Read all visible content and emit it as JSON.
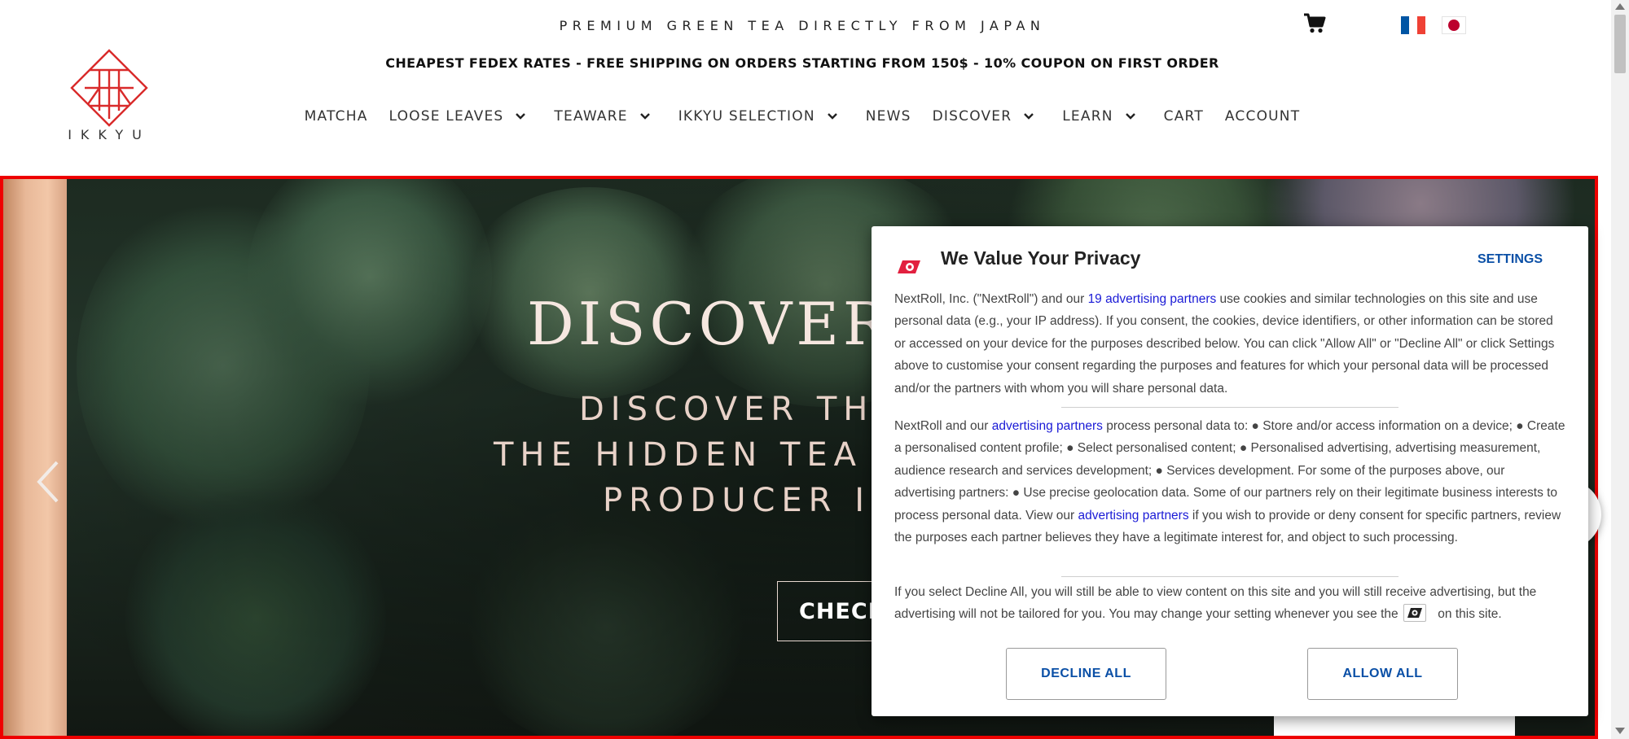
{
  "header": {
    "tagline": "PREMIUM GREEN TEA DIRECTLY FROM JAPAN",
    "promo": "CHEAPEST FEDEX RATES - FREE SHIPPING ON ORDERS STARTING FROM 150$ - 10% COUPON ON FIRST ORDER",
    "logo_text": "IKKYU",
    "cart_icon": "shopping-cart-icon",
    "flags": [
      "france-flag-icon",
      "japan-flag-icon"
    ],
    "nav": [
      {
        "label": "MATCHA",
        "dropdown": false
      },
      {
        "label": "LOOSE LEAVES",
        "dropdown": true
      },
      {
        "label": "TEAWARE",
        "dropdown": true
      },
      {
        "label": "IKKYU SELECTION",
        "dropdown": true
      },
      {
        "label": "NEWS",
        "dropdown": false
      },
      {
        "label": "DISCOVER",
        "dropdown": true
      },
      {
        "label": "LEARN",
        "dropdown": true
      },
      {
        "label": "CART",
        "dropdown": false
      },
      {
        "label": "ACCOUNT",
        "dropdown": false
      }
    ]
  },
  "hero": {
    "title": "DISCOVER",
    "subtitle_lines": [
      "DISCOVER TH",
      "THE HIDDEN TEA",
      "PRODUCER IN"
    ],
    "cta_label": "CHECK",
    "prev_icon": "chevron-left-icon"
  },
  "consent": {
    "title": "We Value Your Privacy",
    "settings_label": "SETTINGS",
    "p1_a": "NextRoll, Inc. (\"NextRoll\") and our ",
    "p1_link": "19 advertising partners",
    "p1_b": " use cookies and similar technologies on this site and use personal data (e.g., your IP address). If you consent, the cookies, device identifiers, or other information can be stored or accessed on your device for the purposes described below. You can click \"Allow All\" or \"Decline All\" or click Settings above to customise your consent regarding the purposes and features for which your personal data will be processed and/or the partners with whom you will share personal data.",
    "p2_a": "NextRoll and our ",
    "p2_link1": "advertising partners",
    "p2_b": " process personal data to: ● Store and/or access information on a device; ● Create a personalised content profile; ● Select personalised content; ● Personalised advertising, advertising measurement, audience research and services development; ● Services development. For some of the purposes above, our advertising partners: ● Use precise geolocation data. Some of our partners rely on their legitimate business interests to process personal data. View our ",
    "p2_link2": "advertising partners",
    "p2_c": " if you wish to provide or deny consent for specific partners, review the purposes each partner believes they have a legitimate interest for, and object to such processing.",
    "p3_a": "If you select Decline All, you will still be able to view content on this site and you will still receive advertising, but the advertising will not be tailored for you. You may change your setting whenever you see the ",
    "p3_b": " on this site.",
    "decline_label": "DECLINE ALL",
    "allow_label": "ALLOW ALL",
    "brand_color": "#e2203f",
    "link_color": "#1a1ad6",
    "button_text_color": "#0a4fa6"
  },
  "colors": {
    "hero_border": "#ee0000",
    "flag_jp_red": "#bc002d"
  }
}
